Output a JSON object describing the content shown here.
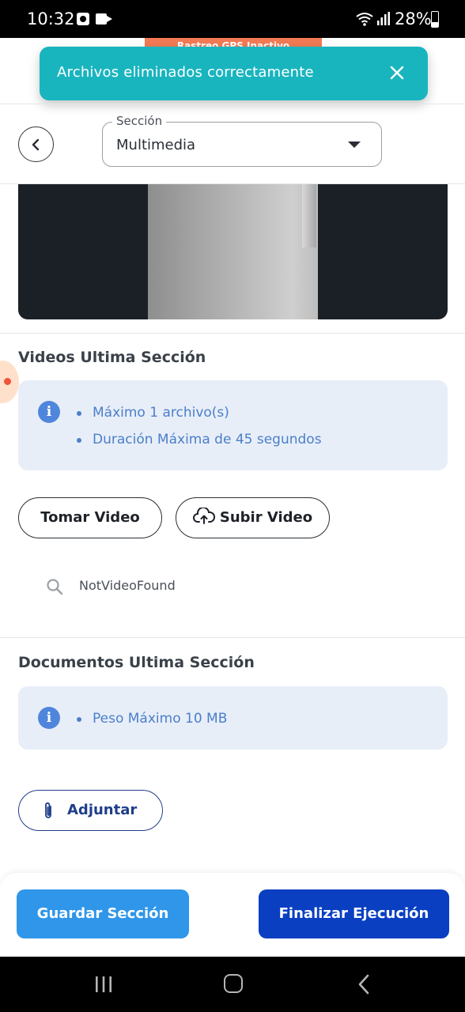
{
  "status_bar": {
    "time": "10:32",
    "battery": "28%"
  },
  "gps_banner": {
    "text": "Rastreo GPS Inactivo"
  },
  "toast": {
    "message": "Archivos eliminados correctamente",
    "close_icon": "close-icon"
  },
  "header": {
    "back_icon": "chevron-left-icon",
    "section_select": {
      "label": "Sección",
      "value": "Multimedia"
    }
  },
  "videos_section": {
    "title": "Videos Ultima Sección",
    "info_items": [
      "Máximo 1 archivo(s)",
      "Duración Máxima de 45 segundos"
    ],
    "take_video_label": "Tomar Video",
    "upload_video_label": "Subir Video",
    "empty_text": "NotVideoFound"
  },
  "documents_section": {
    "title": "Documentos Ultima Sección",
    "info_items": [
      "Peso Máximo 10 MB"
    ],
    "attach_label": "Adjuntar"
  },
  "actions": {
    "save_label": "Guardar Sección",
    "finish_label": "Finalizar Ejecución"
  },
  "colors": {
    "toast": "#19b5bf",
    "info_bg": "#e8eef8",
    "info_accent": "#4f86dc",
    "save_button": "#2f96ea",
    "finish_button": "#0a3fc2",
    "gps_banner": "#f27a55"
  }
}
